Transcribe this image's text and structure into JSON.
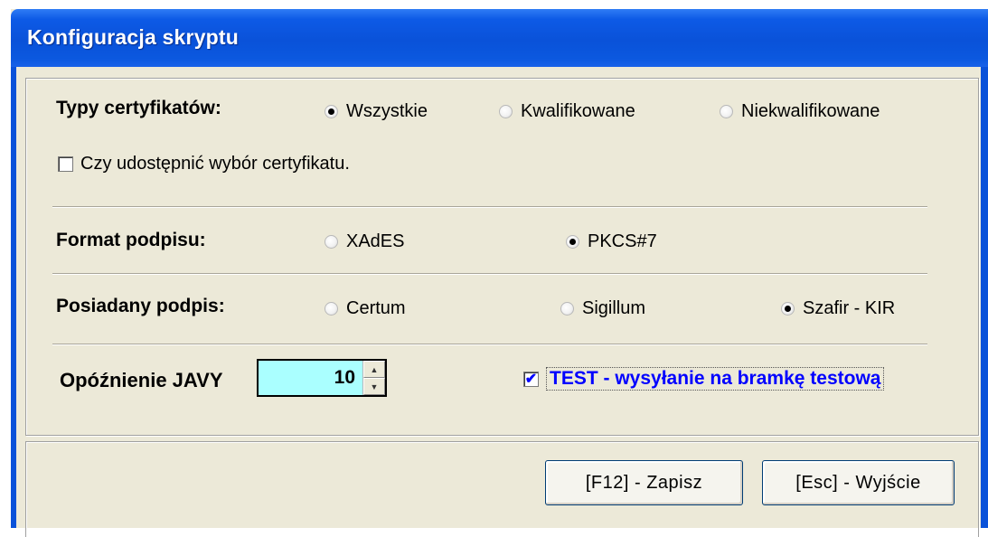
{
  "window": {
    "title": "Konfiguracja skryptu"
  },
  "cert_types": {
    "label": "Typy certyfikatów:",
    "options": [
      "Wszystkie",
      "Kwalifikowane",
      "Niekwalifikowane"
    ],
    "selected": "Wszystkie"
  },
  "share_choice": {
    "label": "Czy udostępnić wybór certyfikatu.",
    "checked": false
  },
  "signature_format": {
    "label": "Format podpisu:",
    "options": [
      "XAdES",
      "PKCS#7"
    ],
    "selected": "PKCS#7"
  },
  "owned_signature": {
    "label": "Posiadany podpis:",
    "options": [
      "Certum",
      "Sigillum",
      "Szafir - KIR"
    ],
    "selected": "Szafir - KIR"
  },
  "java_delay": {
    "label": "Opóźnienie JAVY",
    "value": "10",
    "up": "▲",
    "down": "▼"
  },
  "test_mode": {
    "label": "TEST - wysyłanie na bramkę testową",
    "checked": true,
    "mark": "✔"
  },
  "buttons": {
    "save": "[F12] - Zapisz",
    "exit": "[Esc] - Wyjście"
  },
  "colors": {
    "titlebar": "#0a52d9",
    "spin_bg": "#aaffff",
    "test_text": "#0000ff",
    "dialog_bg": "#ece9d8"
  }
}
